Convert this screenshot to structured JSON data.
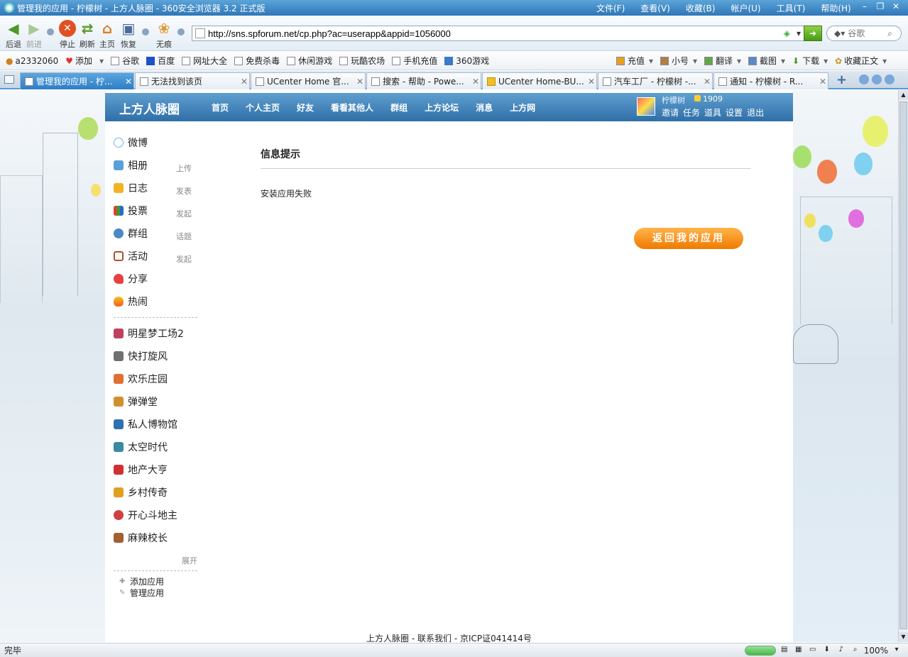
{
  "browser": {
    "title": "管理我的应用 - 柠檬树 - 上方人脉圈 - 360安全浏览器 3.2 正式版",
    "menus": [
      "文件(F)",
      "查看(V)",
      "收藏(B)",
      "帐户(U)",
      "工具(T)",
      "帮助(H)"
    ],
    "nav": {
      "back": "后退",
      "forward": "前进",
      "stop": "停止",
      "refresh": "刷新",
      "home": "主页",
      "restore": "恢复",
      "incognito": "无痕"
    },
    "url": "http://sns.spforum.net/cp.php?ac=userapp&appid=1056000",
    "search_placeholder": "谷歌"
  },
  "bookmarks": {
    "user": "a2332060",
    "add": "添加",
    "items": [
      "谷歌",
      "百度",
      "网址大全",
      "免费杀毒",
      "休闲游戏",
      "玩酷农场",
      "手机充值",
      "360游戏"
    ],
    "right": [
      "充值",
      "小号",
      "翻译",
      "截图",
      "下载",
      "收藏正文"
    ]
  },
  "tabs": [
    {
      "label": "管理我的应用 - 柠...",
      "active": true
    },
    {
      "label": "无法找到该页",
      "active": false
    },
    {
      "label": "UCenter Home 官...",
      "active": false
    },
    {
      "label": "搜索 - 帮助 - Powe...",
      "active": false
    },
    {
      "label": "UCenter Home-BU...",
      "active": false
    },
    {
      "label": "汽车工厂 - 柠檬树 -...",
      "active": false
    },
    {
      "label": "通知 - 柠檬树 - R...",
      "active": false
    }
  ],
  "site": {
    "name": "上方人脉圈",
    "nav": [
      "首页",
      "个人主页",
      "好友",
      "看看其他人",
      "群组",
      "上方论坛",
      "消息",
      "上方网"
    ],
    "user": {
      "name": "柠檬树",
      "coins": "1909",
      "links": [
        "邀请",
        "任务",
        "道具",
        "设置",
        "退出"
      ]
    }
  },
  "sidebar": {
    "features": [
      {
        "label": "微博",
        "sub": "",
        "color": "#6fb7e8"
      },
      {
        "label": "相册",
        "sub": "上传",
        "color": "#5aa0d8"
      },
      {
        "label": "日志",
        "sub": "发表",
        "color": "#f2b323"
      },
      {
        "label": "投票",
        "sub": "发起",
        "color": "#e0402a"
      },
      {
        "label": "群组",
        "sub": "话题",
        "color": "#4a88c6"
      },
      {
        "label": "活动",
        "sub": "发起",
        "color": "#b4502e"
      },
      {
        "label": "分享",
        "sub": "",
        "color": "#e84040"
      },
      {
        "label": "热闹",
        "sub": "",
        "color": "#f06020"
      }
    ],
    "apps": [
      {
        "label": "明星梦工场2",
        "color": "#c04060"
      },
      {
        "label": "快打旋风",
        "color": "#707070"
      },
      {
        "label": "欢乐庄园",
        "color": "#e07030"
      },
      {
        "label": "弹弹堂",
        "color": "#d09030"
      },
      {
        "label": "私人博物馆",
        "color": "#3070b0"
      },
      {
        "label": "太空时代",
        "color": "#3a8aa0"
      },
      {
        "label": "地产大亨",
        "color": "#d03030"
      },
      {
        "label": "乡村传奇",
        "color": "#e0a020"
      },
      {
        "label": "开心斗地主",
        "color": "#d04040"
      },
      {
        "label": "麻辣校长",
        "color": "#a06030"
      }
    ],
    "expand": "展开",
    "add_app": "添加应用",
    "manage_app": "管理应用"
  },
  "message": {
    "heading": "信息提示",
    "text": "安装应用失败",
    "button": "返回我的应用"
  },
  "footer": "上方人脉圈 - 联系我们 - 京ICP证041414号",
  "status": {
    "text": "完毕",
    "zoom": "100%"
  }
}
